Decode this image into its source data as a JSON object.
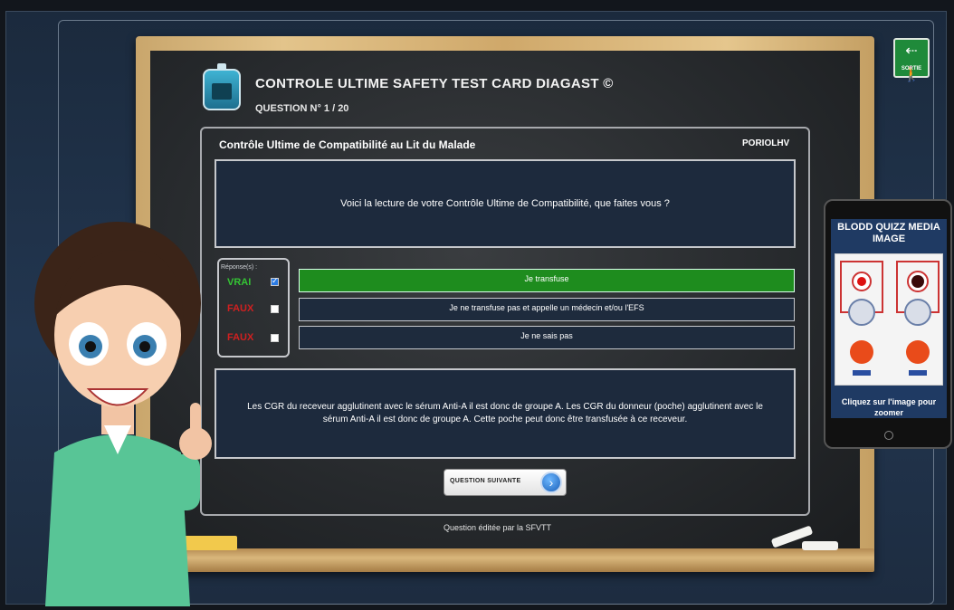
{
  "header": {
    "title": "CONTROLE ULTIME SAFETY TEST CARD DIAGAST ©",
    "question_number": "QUESTION N° 1 / 20"
  },
  "exit": {
    "label": "SORTIE",
    "icon": "exit-door-icon"
  },
  "panel": {
    "title": "Contrôle Ultime de Compatibilité au Lit du Malade",
    "code": "PORIOLHV",
    "question": "Voici la lecture de votre Contrôle Ultime de Compatibilité, que faites vous ?"
  },
  "responses": {
    "header": "Réponse(s) :",
    "rows": [
      {
        "status": "VRAI",
        "status_color": "#34c434",
        "checked": true,
        "answer": "Je transfuse",
        "selected": true
      },
      {
        "status": "FAUX",
        "status_color": "#d02020",
        "checked": false,
        "answer": "Je ne transfuse pas et appelle un médecin et/ou l'EFS",
        "selected": false
      },
      {
        "status": "FAUX",
        "status_color": "#d02020",
        "checked": false,
        "answer": "Je ne sais pas",
        "selected": false
      }
    ]
  },
  "explanation": "Les CGR du receveur agglutinent avec le sérum Anti-A il est donc de groupe A. Les CGR du donneur (poche) agglutinent avec le sérum Anti-A il est donc de groupe A. Cette poche peut donc être transfusée à ce receveur.",
  "next_button": {
    "label": "QUESTION SUIVANTE",
    "icon": "arrow-right-icon"
  },
  "footer": "Question éditée par la SFVTT",
  "tablet": {
    "title": "BLODD QUIZZ MEDIA IMAGE",
    "caption": "Cliquez sur l'image pour zoomer"
  },
  "colors": {
    "accent_green": "#1e8c1e",
    "panel_bg": "#1d2a3d",
    "chalkboard": "#2a2c2e"
  }
}
